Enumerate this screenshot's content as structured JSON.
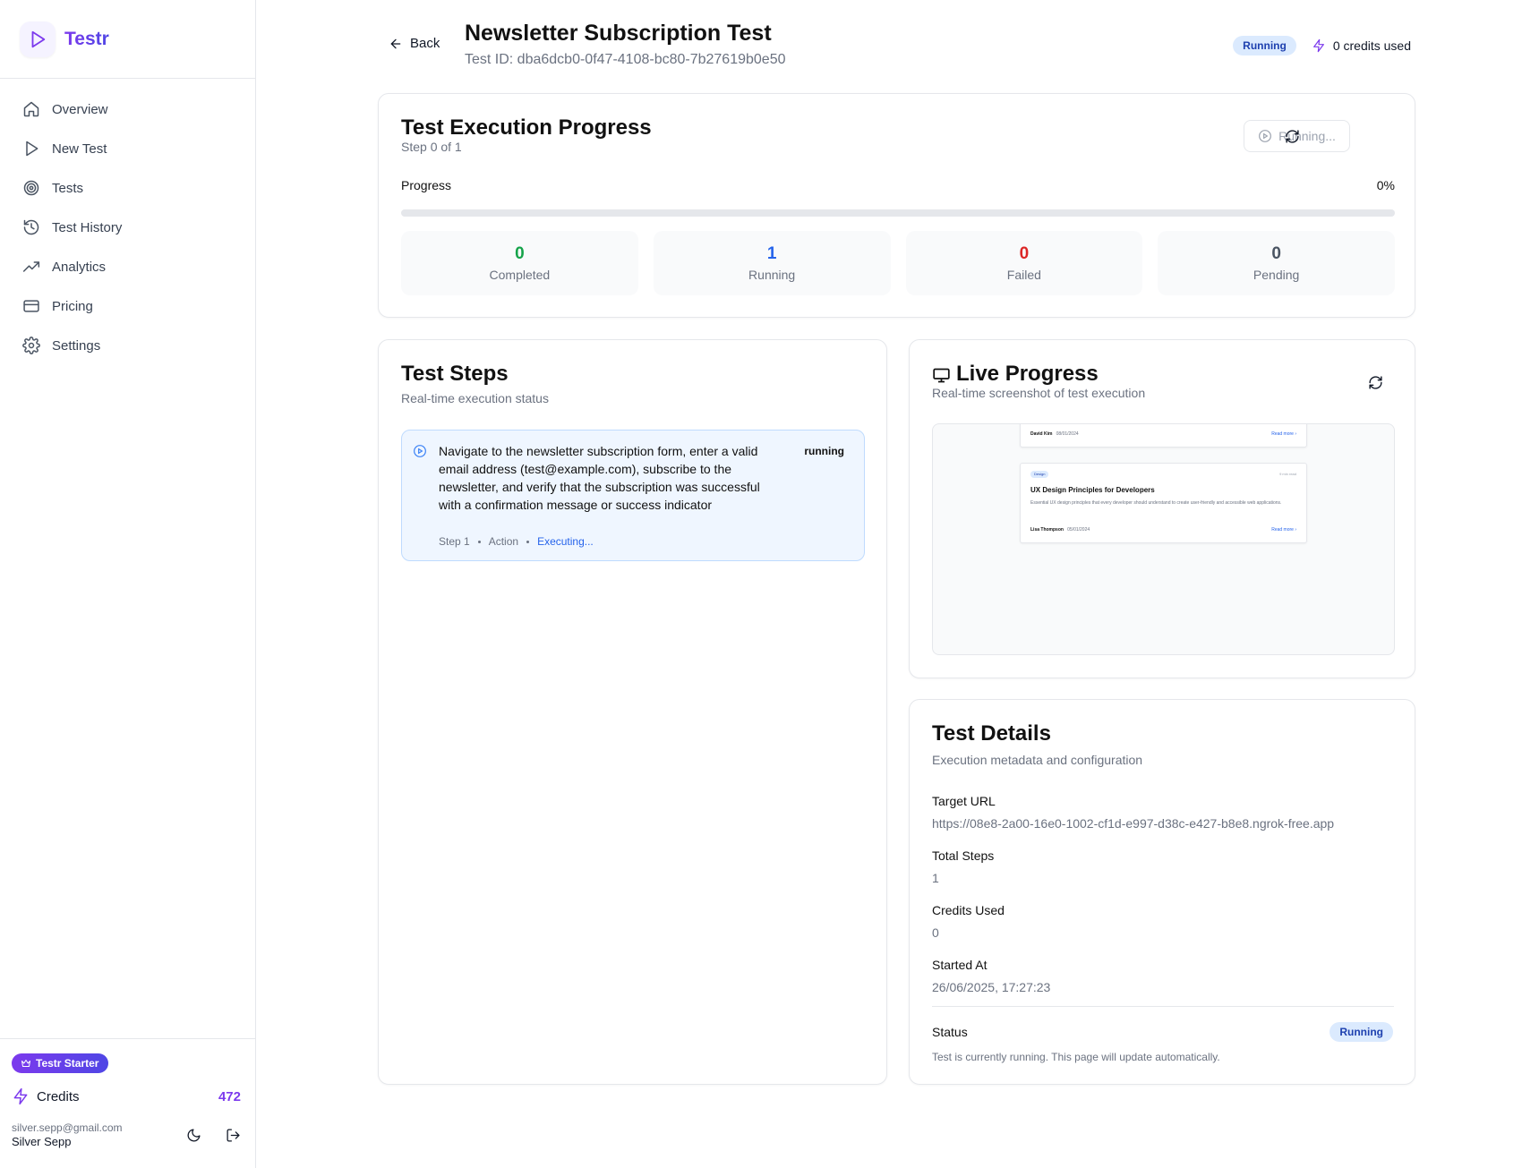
{
  "app": {
    "name": "Testr",
    "brand_color": "#7c3aed"
  },
  "sidebar": {
    "items": [
      {
        "label": "Overview",
        "icon": "home-icon"
      },
      {
        "label": "New Test",
        "icon": "play-icon"
      },
      {
        "label": "Tests",
        "icon": "target-icon"
      },
      {
        "label": "Test History",
        "icon": "history-icon"
      },
      {
        "label": "Analytics",
        "icon": "trending-up-icon"
      },
      {
        "label": "Pricing",
        "icon": "credit-card-icon"
      },
      {
        "label": "Settings",
        "icon": "gear-icon"
      }
    ],
    "plan": "Testr Starter",
    "credits_label": "Credits",
    "credits_value": "472",
    "user_email": "silver.sepp@gmail.com",
    "user_name": "Silver Sepp"
  },
  "header": {
    "back_label": "Back",
    "title": "Newsletter Subscription Test",
    "test_id": "Test ID: dba6dcb0-0f47-4108-bc80-7b27619b0e50",
    "status": "Running",
    "credits_used": "0 credits used"
  },
  "progress": {
    "title": "Test Execution Progress",
    "step_text": "Step 0 of 1",
    "running_button": "Running...",
    "progress_label": "Progress",
    "percent": 0,
    "percent_text": "0%",
    "stats": [
      {
        "value": "0",
        "label": "Completed",
        "color": "#16a34a"
      },
      {
        "value": "1",
        "label": "Running",
        "color": "#2563eb"
      },
      {
        "value": "0",
        "label": "Failed",
        "color": "#dc2626"
      },
      {
        "value": "0",
        "label": "Pending",
        "color": "#4b5563"
      }
    ]
  },
  "steps": {
    "title": "Test Steps",
    "subtitle": "Real-time execution status",
    "items": [
      {
        "description": "Navigate to the newsletter subscription form, enter a valid email address (test@example.com), subscribe to the newsletter, and verify that the subscription was successful with a confirmation message or success indicator",
        "status": "running",
        "step": "Step 1",
        "type": "Action",
        "state": "Executing..."
      }
    ]
  },
  "live": {
    "title": "Live Progress",
    "subtitle": "Real-time screenshot of test execution",
    "preview": {
      "top_author": "David Kim",
      "top_date": "08/01/2024",
      "top_link": "Read more",
      "tag": "Design",
      "read_time": "9 min read",
      "post_title": "UX Design Principles for Developers",
      "post_desc": "Essential UX design principles that every developer should understand to create user-friendly and accessible web applications.",
      "author": "Lisa Thompson",
      "date": "05/01/2024",
      "link": "Read more"
    }
  },
  "details": {
    "title": "Test Details",
    "subtitle": "Execution metadata and configuration",
    "fields": [
      {
        "label": "Target URL",
        "value": "https://08e8-2a00-16e0-1002-cf1d-e997-d38c-e427-b8e8.ngrok-free.app"
      },
      {
        "label": "Total Steps",
        "value": "1"
      },
      {
        "label": "Credits Used",
        "value": "0"
      },
      {
        "label": "Started At",
        "value": "26/06/2025, 17:27:23"
      }
    ],
    "status_label": "Status",
    "status_value": "Running",
    "status_note": "Test is currently running. This page will update automatically."
  }
}
